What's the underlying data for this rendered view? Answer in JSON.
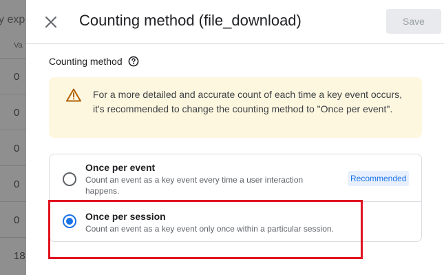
{
  "background": {
    "header_fragment": "y exp",
    "column_fragment": "Va",
    "cells": [
      "0",
      "0",
      "0",
      "0",
      "0",
      "18"
    ]
  },
  "drawer": {
    "title": "Counting method (file_download)",
    "save_label": "Save",
    "close_icon": "close-icon",
    "section_label": "Counting method",
    "help_icon": "help-circle-icon",
    "warning": {
      "icon": "warning-triangle-icon",
      "text": "For a more detailed and accurate count of each time a key event occurs, it's recommended to change the counting method to \"Once per event\"."
    },
    "options": [
      {
        "title": "Once per event",
        "description": "Count an event as a key event every time a user interaction happens.",
        "badge": "Recommended",
        "selected": false
      },
      {
        "title": "Once per session",
        "description": "Count an event as a key event only once within a particular session.",
        "selected": true
      }
    ]
  },
  "colors": {
    "accent": "#1a73e8",
    "warning_bg": "#fef7e0",
    "warning_icon": "#b06000",
    "highlight": "#e0131f"
  }
}
